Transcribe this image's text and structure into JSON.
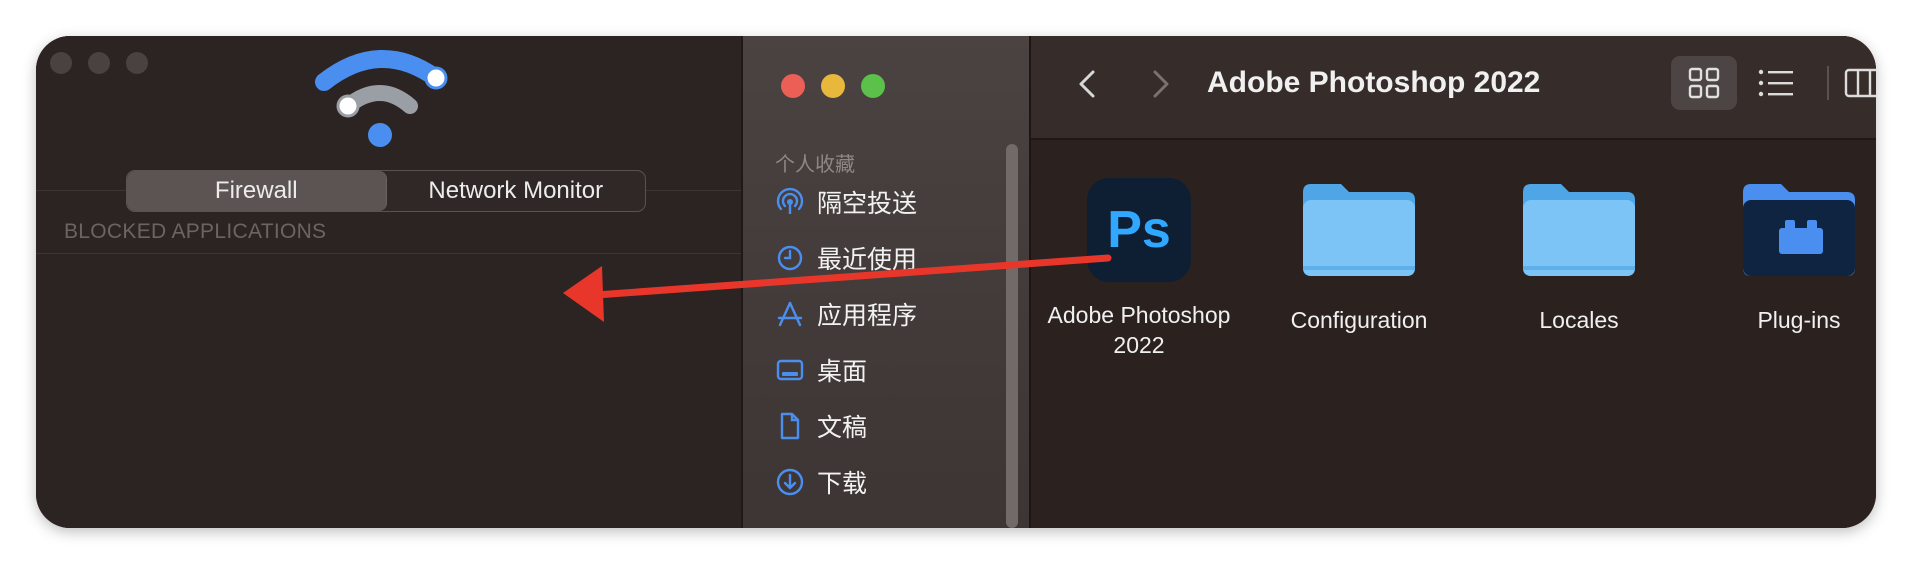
{
  "firewall": {
    "tabs": [
      "Firewall",
      "Network Monitor"
    ],
    "active_tab": "Firewall",
    "section_header": "BLOCKED APPLICATIONS",
    "logo_icon": "wifi-logo-icon"
  },
  "sidebar": {
    "header": "个人收藏",
    "items": [
      {
        "label": "隔空投送",
        "icon": "airdrop-icon"
      },
      {
        "label": "最近使用",
        "icon": "clock-icon"
      },
      {
        "label": "应用程序",
        "icon": "applications-icon"
      },
      {
        "label": "桌面",
        "icon": "desktop-icon"
      },
      {
        "label": "文稿",
        "icon": "document-icon"
      },
      {
        "label": "下载",
        "icon": "download-icon"
      }
    ]
  },
  "finder": {
    "title": "Adobe Photoshop 2022",
    "view_mode": "icon",
    "items": [
      {
        "name": "Adobe Photoshop\n2022",
        "line1": "Adobe Photoshop",
        "line2": "2022",
        "type": "app",
        "badge": "Ps"
      },
      {
        "name": "Configuration",
        "type": "folder"
      },
      {
        "name": "Locales",
        "type": "folder"
      },
      {
        "name": "Plug-ins",
        "type": "plugin-folder"
      }
    ]
  },
  "colors": {
    "accent_blue": "#4a8ef0",
    "folder_blue": "#7cc4f5",
    "annotation_arrow": "#e8362b",
    "close": "#ec5f57",
    "minimize": "#e7b83c",
    "zoom": "#5cc14a"
  }
}
